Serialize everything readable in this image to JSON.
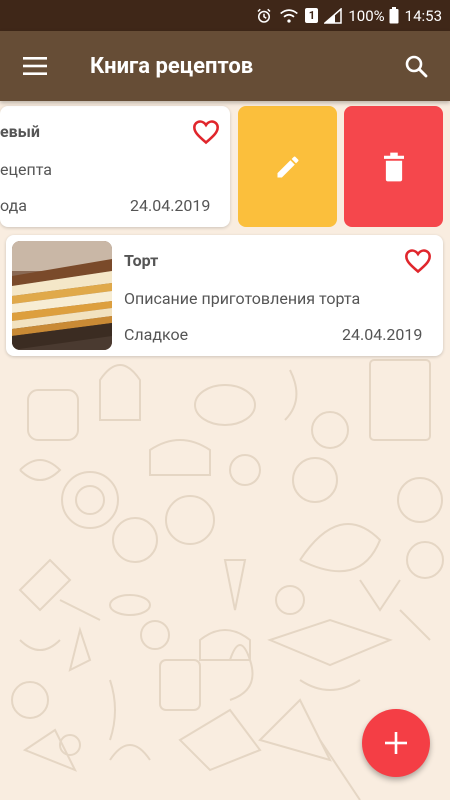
{
  "status_bar": {
    "battery": "100%",
    "time": "14:53",
    "sim_badge": "1"
  },
  "app_bar": {
    "title": "Книга рецептов",
    "menu_icon": "hamburger-menu-icon",
    "search_icon": "search-icon"
  },
  "recipes": [
    {
      "title_visible": "евый",
      "description_visible": "ецепта",
      "category_visible": "ода",
      "date": "24.04.2019",
      "favorite": false
    },
    {
      "title": "Торт",
      "description": "Описание приготовления торта",
      "category": "Сладкое",
      "date": "24.04.2019",
      "favorite": false,
      "image_icon": "cake-image"
    }
  ],
  "swipe_actions": {
    "edit_icon": "pencil-icon",
    "delete_icon": "trash-icon"
  },
  "fab_icon": "plus-icon",
  "colors": {
    "status_bar": "#3f2718",
    "app_bar": "#664d36",
    "background": "#f9ede0",
    "edit": "#fbbf3c",
    "delete": "#f5474c",
    "fab": "#f43e45",
    "heart": "#e0262c"
  }
}
